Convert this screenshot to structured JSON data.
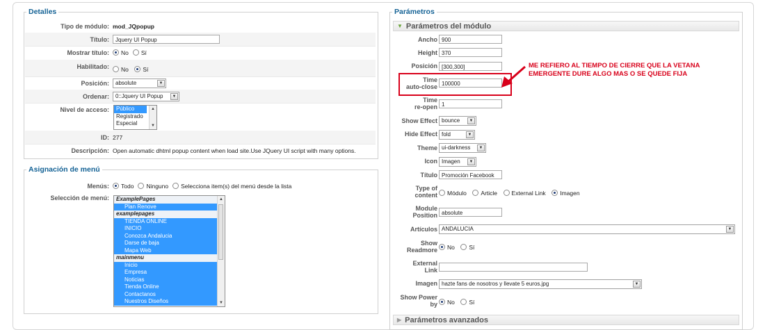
{
  "detalles": {
    "legend": "Detalles",
    "tipo_label": "Tipo de módulo:",
    "tipo_value": "mod_JQpopup",
    "titulo_label": "Título:",
    "titulo_value": "Jquery UI Popup",
    "mostrar_label": "Mostrar título:",
    "mostrar_no": "No",
    "mostrar_si": "Sí",
    "habilitado_label": "Habilitado:",
    "hab_no": "No",
    "hab_si": "Sí",
    "posicion_label": "Posición:",
    "posicion_value": "absolute",
    "ordenar_label": "Ordenar:",
    "ordenar_value": "0::Jquery UI Popup",
    "acceso_label": "Nivel de acceso:",
    "acceso_options": [
      "Público",
      "Registrado",
      "Especial"
    ],
    "id_label": "ID:",
    "id_value": "277",
    "desc_label": "Descripción:",
    "desc_value": "Open automatic dhtml popup content when load site.Use JQuery UI script with many options."
  },
  "asignacion": {
    "legend": "Asignación de menú",
    "menus_label": "Menús:",
    "opt_todo": "Todo",
    "opt_ninguno": "Ninguno",
    "opt_selecciona": "Selecciona item(s) del menú desde la lista",
    "seleccion_label": "Selección de menú:",
    "items": [
      "ExamplePages",
      "Plan Renove",
      "examplepages",
      "TIENDA ONLINE",
      "INICIO",
      "Conozca Andalucia",
      "Darse de baja",
      "Mapa Web",
      "mainmenu",
      "Inicio",
      "Empresa",
      "Noticias",
      "Tienda Online",
      "Contactanos",
      "Nuestros Diseños"
    ]
  },
  "parametros": {
    "legend": "Parámetros",
    "panel_title": "Parámetros del módulo",
    "ancho_label": "Ancho",
    "ancho_value": "900",
    "height_label": "Height",
    "height_value": "370",
    "posicion_label": "Posición",
    "posicion_value": "[300,300]",
    "timeclose_label1": "Time",
    "timeclose_label2": "auto-close",
    "timeclose_value": "100000",
    "timereopen_label1": "Time",
    "timereopen_label2": "re-open",
    "timereopen_value": "1",
    "show_label": "Show Effect",
    "show_value": "bounce",
    "hide_label": "Hide Effect",
    "hide_value": "fold",
    "theme_label": "Theme",
    "theme_value": "ui-darkness",
    "icon_label": "Icon",
    "icon_value": "Imagen",
    "titulo_label": "Título",
    "titulo_value": "Promoción Facebook",
    "type_label1": "Type of",
    "type_label2": "content",
    "type_opts": [
      "Módulo",
      "Article",
      "External Link",
      "Imagen"
    ],
    "modpos_label1": "Module",
    "modpos_label2": "Position",
    "modpos_value": "absolute",
    "articulos_label": "Artículos",
    "articulos_value": "ANDALUCIA",
    "readmore_label1": "Show",
    "readmore_label2": "Readmore",
    "readmore_no": "No",
    "readmore_si": "Sí",
    "extlink_label1": "External",
    "extlink_label2": "Link",
    "extlink_value": "",
    "imagen_label": "Imagen",
    "imagen_value": "hazte fans de nosotros y llevate 5 euros.jpg",
    "power_label1": "Show Power",
    "power_label2": "by",
    "power_no": "No",
    "power_si": "Sí",
    "avanzados_title": "Parámetros avanzados"
  },
  "annotation": {
    "line1": "ME REFIERO AL TIEMPO DE CIERRE QUE LA VETANA",
    "line2": "EMERGENTE DURE ALGO MAS O SE QUEDE FIJA",
    "color": "#d8001a"
  }
}
